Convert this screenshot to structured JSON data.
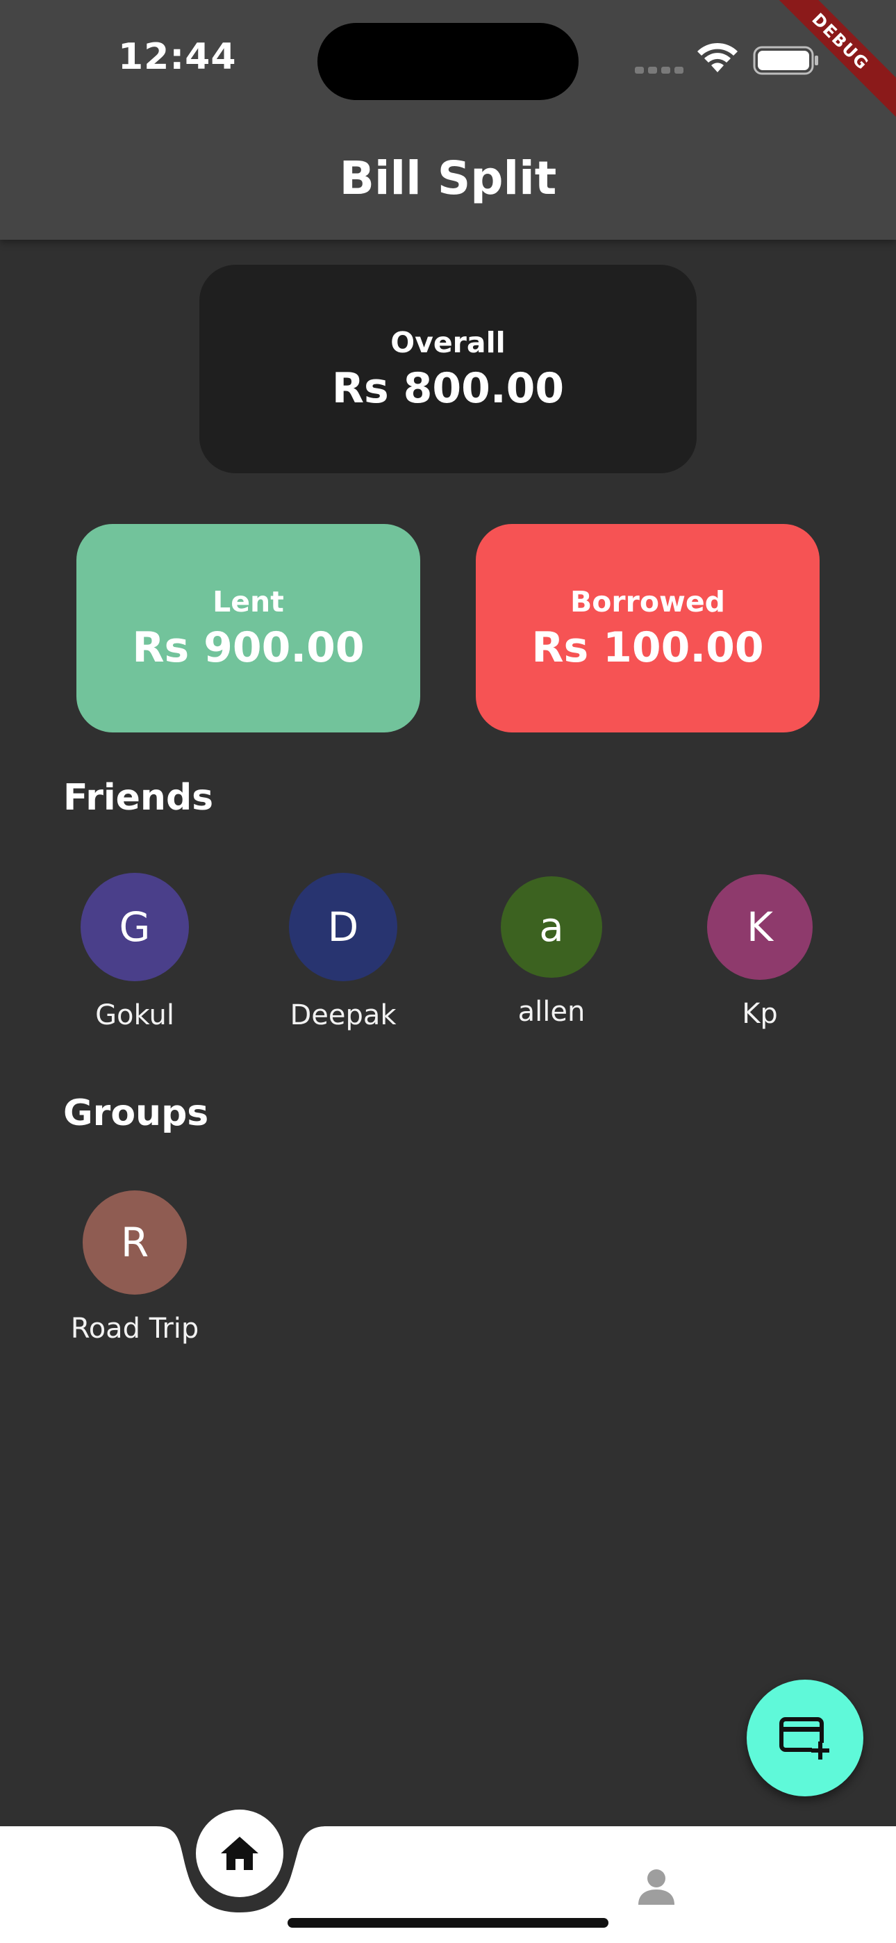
{
  "status_bar": {
    "time": "12:44"
  },
  "debug_label": "DEBUG",
  "app_bar": {
    "title": "Bill Split"
  },
  "summary": {
    "overall": {
      "label": "Overall",
      "value": "Rs 800.00"
    },
    "lent": {
      "label": "Lent",
      "value": "Rs 900.00"
    },
    "borrowed": {
      "label": "Borrowed",
      "value": "Rs 100.00"
    }
  },
  "friends": {
    "title": "Friends",
    "items": [
      {
        "initial": "G",
        "name": "Gokul",
        "color": "#4a3f8a"
      },
      {
        "initial": "D",
        "name": "Deepak",
        "color": "#283470"
      },
      {
        "initial": "a",
        "name": "allen",
        "color": "#3c6220"
      },
      {
        "initial": "K",
        "name": "Kp",
        "color": "#8e3a6c"
      }
    ]
  },
  "groups": {
    "title": "Groups",
    "items": [
      {
        "initial": "R",
        "name": "Road Trip",
        "color": "#8f5c52"
      }
    ]
  },
  "fab": {
    "icon": "add-card-icon"
  },
  "bottom_nav": {
    "items": [
      {
        "icon": "home-icon",
        "active": true
      },
      {
        "icon": "person-icon",
        "active": false
      }
    ]
  },
  "colors": {
    "background": "#303030",
    "app_bar": "#454545",
    "overall_card": "#1f1f1f",
    "lent_card": "#72c39b",
    "borrowed_card": "#f65354",
    "fab": "#5ff9d9"
  }
}
